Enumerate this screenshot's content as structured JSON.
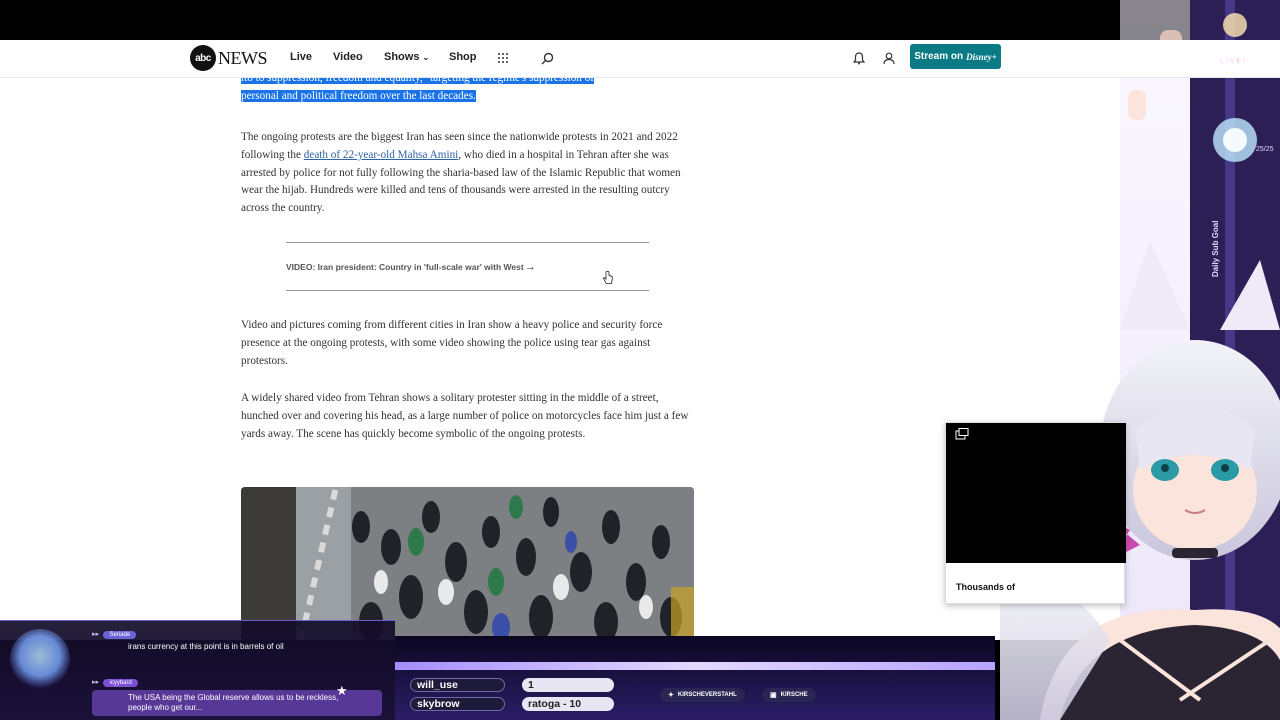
{
  "nav": {
    "logo_mark": "abc",
    "logo_text": "NEWS",
    "links": [
      "Live",
      "Video",
      "Shows",
      "Shop"
    ],
    "stream_label": "Stream on",
    "stream_brand": "Disney+"
  },
  "article": {
    "highlight_line1": "ito to suppression, freedom and equality,\" targeting the regime's suppression of",
    "highlight_line2": "personal and political freedom over the last decades.",
    "para1_before": "The ongoing protests are the biggest Iran has seen since the nationwide protests in 2021 and 2022 following the ",
    "para1_link": "death of 22-year-old Mahsa Amini",
    "para1_after": ", who died in a hospital in Tehran after she was arrested by police for not fully following the sharia-based law of the Islamic Republic that women wear the hijab. Hundreds were killed and tens of thousands were arrested in the resulting outcry across the country.",
    "video_link": "VIDEO: Iran president: Country in 'full-scale war' with West",
    "para2": "Video and pictures coming from different cities in Iran show a heavy police and security force presence at the ongoing protests, with some video showing the police using tear gas against protestors.",
    "para3": "A widely shared video from Tehran shows a solitary protester sitting in the middle of a street, hunched over and covering his head, as a large number of police on motorcycles face him just a few yards away. The scene has quickly become symbolic of the ongoing protests."
  },
  "popup": {
    "caption": "Thousands of"
  },
  "chat": {
    "messages": [
      {
        "user": "Seriade",
        "text": "irans currency at this point is in barrels of oil",
        "color": "#6c63d9"
      },
      {
        "user": "icyybard",
        "text": "The USA being the Global reserve allows us to be reckless, people who get our...",
        "color": "#7b4fd6"
      }
    ]
  },
  "banner": {
    "pill1": "will_use",
    "pill2": "1",
    "pill3": "skybrow",
    "pill4": "ratoga - 10",
    "social1": "KIRSCHEVERSTAHL",
    "social2": "KIRSCHE"
  },
  "stream": {
    "live": "LIVE!",
    "goal_label": "Daily Sub Goal",
    "goal_count": "25/25"
  }
}
